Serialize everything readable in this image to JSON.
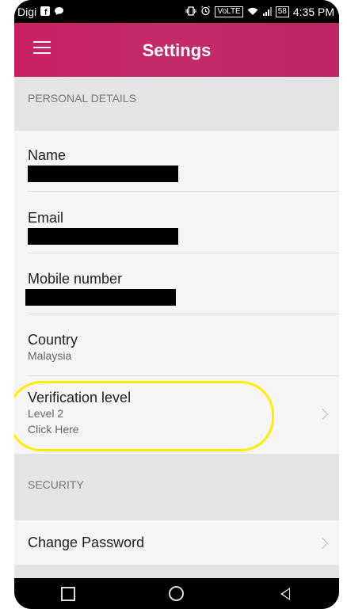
{
  "status_bar": {
    "carrier": "Digi",
    "time": "4:35 PM",
    "battery": "58",
    "network_label": "VoLTE"
  },
  "app_bar": {
    "title": "Settings"
  },
  "sections": {
    "personal_details": "PERSONAL DETAILS",
    "security": "SECURITY"
  },
  "rows": {
    "name": {
      "title": "Name"
    },
    "email": {
      "title": "Email"
    },
    "mobile": {
      "title": "Mobile number"
    },
    "country": {
      "title": "Country",
      "value": "Malaysia"
    },
    "verification": {
      "title": "Verification level",
      "value": "Level 2",
      "action": "Click Here"
    },
    "change_password": {
      "title": "Change Password"
    }
  },
  "colors": {
    "app_bar": "#c82063",
    "highlight": "#ffee00",
    "section_header": "#e4e4e4",
    "list_background": "#f5f5f5"
  }
}
